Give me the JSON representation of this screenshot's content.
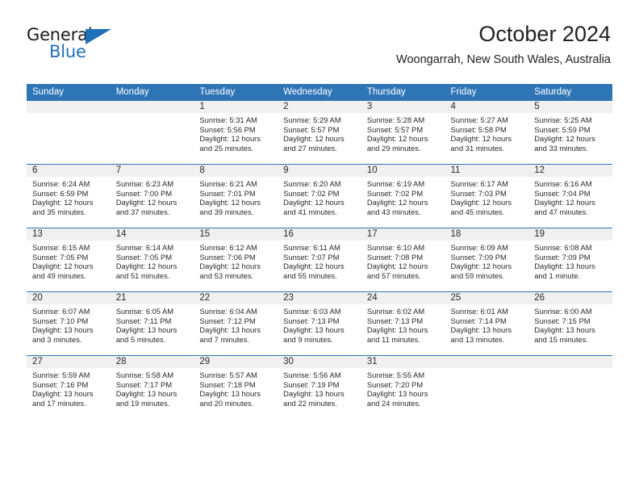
{
  "logo": {
    "word_top": "General",
    "word_bottom": "Blue",
    "accent_color": "#1f70b8"
  },
  "header": {
    "title": "October 2024",
    "subtitle": "Woongarrah, New South Wales, Australia"
  },
  "theme": {
    "header_blue": "#2e75b6",
    "daynum_band": "#f0f0f0"
  },
  "calendar": {
    "weekday_headers": [
      "Sunday",
      "Monday",
      "Tuesday",
      "Wednesday",
      "Thursday",
      "Friday",
      "Saturday"
    ],
    "weeks": [
      [
        {
          "empty": true
        },
        {
          "empty": true
        },
        {
          "day": "1",
          "sunrise": "Sunrise: 5:31 AM",
          "sunset": "Sunset: 5:56 PM",
          "daylight": "Daylight: 12 hours and 25 minutes."
        },
        {
          "day": "2",
          "sunrise": "Sunrise: 5:29 AM",
          "sunset": "Sunset: 5:57 PM",
          "daylight": "Daylight: 12 hours and 27 minutes."
        },
        {
          "day": "3",
          "sunrise": "Sunrise: 5:28 AM",
          "sunset": "Sunset: 5:57 PM",
          "daylight": "Daylight: 12 hours and 29 minutes."
        },
        {
          "day": "4",
          "sunrise": "Sunrise: 5:27 AM",
          "sunset": "Sunset: 5:58 PM",
          "daylight": "Daylight: 12 hours and 31 minutes."
        },
        {
          "day": "5",
          "sunrise": "Sunrise: 5:25 AM",
          "sunset": "Sunset: 5:59 PM",
          "daylight": "Daylight: 12 hours and 33 minutes."
        }
      ],
      [
        {
          "day": "6",
          "sunrise": "Sunrise: 6:24 AM",
          "sunset": "Sunset: 6:59 PM",
          "daylight": "Daylight: 12 hours and 35 minutes."
        },
        {
          "day": "7",
          "sunrise": "Sunrise: 6:23 AM",
          "sunset": "Sunset: 7:00 PM",
          "daylight": "Daylight: 12 hours and 37 minutes."
        },
        {
          "day": "8",
          "sunrise": "Sunrise: 6:21 AM",
          "sunset": "Sunset: 7:01 PM",
          "daylight": "Daylight: 12 hours and 39 minutes."
        },
        {
          "day": "9",
          "sunrise": "Sunrise: 6:20 AM",
          "sunset": "Sunset: 7:02 PM",
          "daylight": "Daylight: 12 hours and 41 minutes."
        },
        {
          "day": "10",
          "sunrise": "Sunrise: 6:19 AM",
          "sunset": "Sunset: 7:02 PM",
          "daylight": "Daylight: 12 hours and 43 minutes."
        },
        {
          "day": "11",
          "sunrise": "Sunrise: 6:17 AM",
          "sunset": "Sunset: 7:03 PM",
          "daylight": "Daylight: 12 hours and 45 minutes."
        },
        {
          "day": "12",
          "sunrise": "Sunrise: 6:16 AM",
          "sunset": "Sunset: 7:04 PM",
          "daylight": "Daylight: 12 hours and 47 minutes."
        }
      ],
      [
        {
          "day": "13",
          "sunrise": "Sunrise: 6:15 AM",
          "sunset": "Sunset: 7:05 PM",
          "daylight": "Daylight: 12 hours and 49 minutes."
        },
        {
          "day": "14",
          "sunrise": "Sunrise: 6:14 AM",
          "sunset": "Sunset: 7:05 PM",
          "daylight": "Daylight: 12 hours and 51 minutes."
        },
        {
          "day": "15",
          "sunrise": "Sunrise: 6:12 AM",
          "sunset": "Sunset: 7:06 PM",
          "daylight": "Daylight: 12 hours and 53 minutes."
        },
        {
          "day": "16",
          "sunrise": "Sunrise: 6:11 AM",
          "sunset": "Sunset: 7:07 PM",
          "daylight": "Daylight: 12 hours and 55 minutes."
        },
        {
          "day": "17",
          "sunrise": "Sunrise: 6:10 AM",
          "sunset": "Sunset: 7:08 PM",
          "daylight": "Daylight: 12 hours and 57 minutes."
        },
        {
          "day": "18",
          "sunrise": "Sunrise: 6:09 AM",
          "sunset": "Sunset: 7:09 PM",
          "daylight": "Daylight: 12 hours and 59 minutes."
        },
        {
          "day": "19",
          "sunrise": "Sunrise: 6:08 AM",
          "sunset": "Sunset: 7:09 PM",
          "daylight": "Daylight: 13 hours and 1 minute."
        }
      ],
      [
        {
          "day": "20",
          "sunrise": "Sunrise: 6:07 AM",
          "sunset": "Sunset: 7:10 PM",
          "daylight": "Daylight: 13 hours and 3 minutes."
        },
        {
          "day": "21",
          "sunrise": "Sunrise: 6:05 AM",
          "sunset": "Sunset: 7:11 PM",
          "daylight": "Daylight: 13 hours and 5 minutes."
        },
        {
          "day": "22",
          "sunrise": "Sunrise: 6:04 AM",
          "sunset": "Sunset: 7:12 PM",
          "daylight": "Daylight: 13 hours and 7 minutes."
        },
        {
          "day": "23",
          "sunrise": "Sunrise: 6:03 AM",
          "sunset": "Sunset: 7:13 PM",
          "daylight": "Daylight: 13 hours and 9 minutes."
        },
        {
          "day": "24",
          "sunrise": "Sunrise: 6:02 AM",
          "sunset": "Sunset: 7:13 PM",
          "daylight": "Daylight: 13 hours and 11 minutes."
        },
        {
          "day": "25",
          "sunrise": "Sunrise: 6:01 AM",
          "sunset": "Sunset: 7:14 PM",
          "daylight": "Daylight: 13 hours and 13 minutes."
        },
        {
          "day": "26",
          "sunrise": "Sunrise: 6:00 AM",
          "sunset": "Sunset: 7:15 PM",
          "daylight": "Daylight: 13 hours and 15 minutes."
        }
      ],
      [
        {
          "day": "27",
          "sunrise": "Sunrise: 5:59 AM",
          "sunset": "Sunset: 7:16 PM",
          "daylight": "Daylight: 13 hours and 17 minutes."
        },
        {
          "day": "28",
          "sunrise": "Sunrise: 5:58 AM",
          "sunset": "Sunset: 7:17 PM",
          "daylight": "Daylight: 13 hours and 19 minutes."
        },
        {
          "day": "29",
          "sunrise": "Sunrise: 5:57 AM",
          "sunset": "Sunset: 7:18 PM",
          "daylight": "Daylight: 13 hours and 20 minutes."
        },
        {
          "day": "30",
          "sunrise": "Sunrise: 5:56 AM",
          "sunset": "Sunset: 7:19 PM",
          "daylight": "Daylight: 13 hours and 22 minutes."
        },
        {
          "day": "31",
          "sunrise": "Sunrise: 5:55 AM",
          "sunset": "Sunset: 7:20 PM",
          "daylight": "Daylight: 13 hours and 24 minutes."
        },
        {
          "empty": true
        },
        {
          "empty": true
        }
      ]
    ]
  }
}
